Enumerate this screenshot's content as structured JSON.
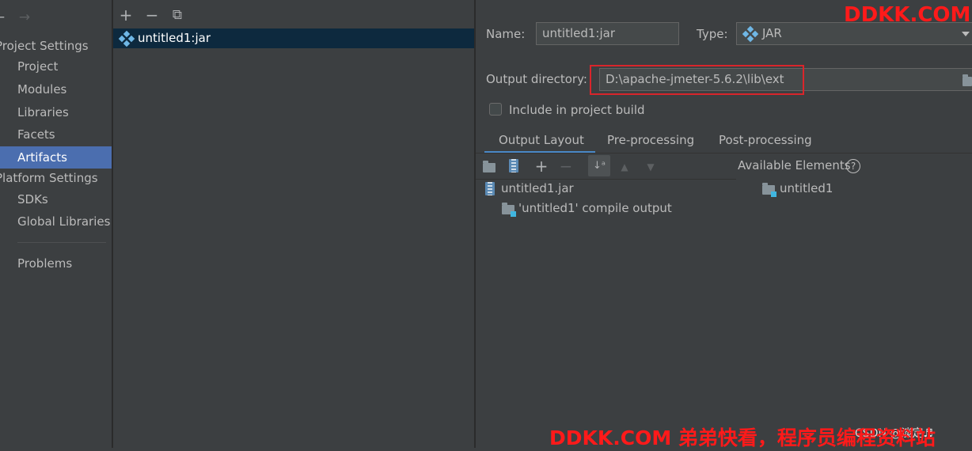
{
  "nav": {
    "back": "←",
    "forward": "→",
    "project_settings": "Project Settings",
    "items": [
      "Project",
      "Modules",
      "Libraries",
      "Facets",
      "Artifacts"
    ],
    "platform_settings": "Platform Settings",
    "platform_items": [
      "SDKs",
      "Global Libraries"
    ],
    "problems": "Problems"
  },
  "artifacts_toolbar": {
    "add": "+",
    "remove": "−",
    "copy": "⧉"
  },
  "artifact_list": [
    "untitled1:jar"
  ],
  "form": {
    "name_label": "Name:",
    "name_value": "untitled1:jar",
    "type_label": "Type:",
    "type_value": "JAR",
    "output_dir_label": "Output directory:",
    "output_dir_value": "D:\\apache-jmeter-5.6.2\\lib\\ext",
    "include_label": "Include in project build",
    "include_checked": false
  },
  "tabs": [
    "Output Layout",
    "Pre-processing",
    "Post-processing"
  ],
  "active_tab": "Output Layout",
  "layout_tree": [
    {
      "label": "untitled1.jar",
      "icon": "jar-icon"
    },
    {
      "label": "'untitled1' compile output",
      "icon": "folder-module-icon"
    }
  ],
  "available": {
    "title": "Available Elements",
    "help": "?",
    "items": [
      "untitled1"
    ]
  },
  "watermark": {
    "top": "DDKK.COM",
    "bottom": "DDKK.COM 弟弟快看，程序员编程资料站",
    "csdn": "CSDN @淡定♬"
  },
  "colors": {
    "background": "#3c3f41",
    "selection": "#4b6eaf",
    "list_selection": "#0d293e",
    "highlight_box": "#d9252b",
    "watermark": "#ff1a1a"
  }
}
